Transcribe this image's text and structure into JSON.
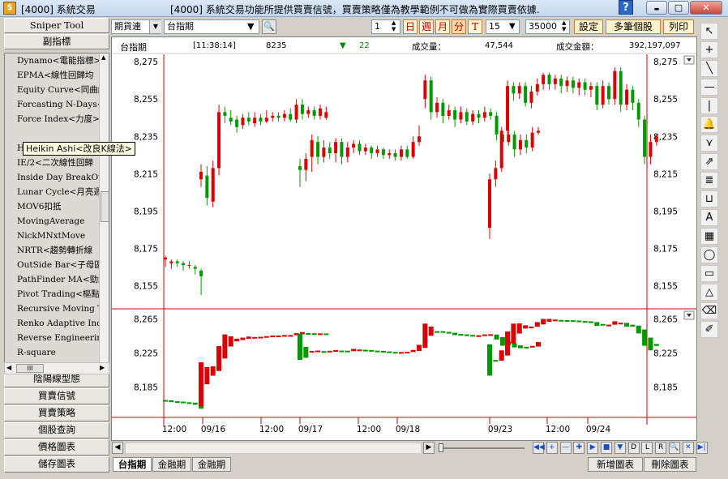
{
  "window": {
    "app_title": "[4000] 系統交易",
    "notice": "[4000] 系統交易功能所提供買賣信號，買賣策略僅為教學範例不可做為實際買賣依據.",
    "help_label": "?",
    "min_label": "▬",
    "max_label": "▢",
    "close_label": "✕"
  },
  "left_panel": {
    "top_buttons": [
      "Sniper Tool",
      "副指標"
    ],
    "indicators": [
      "Dynamo<電能指標>",
      "EPMA<線性回歸均",
      "Equity Curve<同曲線",
      "Forcasting N-Days<",
      "Force Index<力度>",
      "Heikin Ashi<改良K線法>",
      "HighLowLine<高低線",
      "IE/2<二次線性回歸",
      "Inside Day BreakOut",
      "Lunar Cycle<月亮週",
      "MOV6扣抵",
      "MovingAverage",
      "NickMNxtMove",
      "NRTR<趨勢轉折線",
      "OutSide Bar<子母區",
      "PathFinder MA<勁線",
      "Pivot Trading<樞點",
      "Recursive Moving T.",
      "Renko Adaptive Indi",
      "Reverse Engineering",
      "R-square"
    ],
    "tooltip": "Heikin Ashi<改良K線法>",
    "hscroll_label": "III",
    "bottom_buttons": [
      "陰陽線型態",
      "買賣信號",
      "買賣策略",
      "個股查詢",
      "價格圖表",
      "儲存圖表"
    ]
  },
  "toolbar": {
    "contract": "期貨連",
    "symbol": "台指期",
    "period_count": "1",
    "period_buttons": [
      "日",
      "週",
      "月",
      "分",
      "T"
    ],
    "interval": "15",
    "bars": "35000",
    "settings_label": "設定",
    "multi_label": "多筆個股",
    "print_label": "列印"
  },
  "quote": {
    "symbol": "台指期",
    "time": "[11:38:14]",
    "price": "8235",
    "arrow": "▼",
    "change": "22",
    "volume_label": "成交量：",
    "volume": "47,544",
    "amount_label": "成交金額：",
    "amount": "392,197,097"
  },
  "chart_data": [
    {
      "type": "candlestick",
      "panel": "main",
      "y_ticks": [
        "8,275",
        "8,255",
        "8,235",
        "8,215",
        "8,195",
        "8,175",
        "8,155"
      ],
      "ylim": [
        8143,
        8279
      ],
      "candles": [
        [
          8169,
          8170,
          8165,
          8171
        ],
        [
          8167,
          8168,
          8164,
          8169
        ],
        [
          8168,
          8167,
          8165,
          8169
        ],
        [
          8167,
          8166,
          8163,
          8168
        ],
        [
          8166,
          8166,
          8164,
          8168
        ],
        [
          8165,
          8164,
          8161,
          8166
        ],
        [
          8163,
          8160,
          8150,
          8164
        ],
        [
          8212,
          8216,
          8208,
          8220
        ],
        [
          8214,
          8202,
          8198,
          8219
        ],
        [
          8200,
          8218,
          8197,
          8222
        ],
        [
          8218,
          8248,
          8214,
          8252
        ],
        [
          8248,
          8246,
          8242,
          8251
        ],
        [
          8245,
          8243,
          8241,
          8249
        ],
        [
          8244,
          8240,
          8237,
          8246
        ],
        [
          8241,
          8245,
          8239,
          8247
        ],
        [
          8245,
          8243,
          8241,
          8248
        ],
        [
          8242,
          8245,
          8240,
          8248
        ],
        [
          8245,
          8243,
          8241,
          8247
        ],
        [
          8243,
          8245,
          8242,
          8249
        ],
        [
          8245,
          8246,
          8243,
          8248
        ],
        [
          8246,
          8245,
          8243,
          8248
        ],
        [
          8245,
          8247,
          8243,
          8249
        ],
        [
          8247,
          8244,
          8243,
          8250
        ],
        [
          8244,
          8252,
          8242,
          8255
        ],
        [
          8252,
          8247,
          8244,
          8255
        ],
        [
          8247,
          8249,
          8245,
          8251
        ],
        [
          8249,
          8246,
          8244,
          8251
        ],
        [
          8246,
          8250,
          8244,
          8252
        ],
        [
          8245,
          8248,
          8244,
          8251
        ],
        [
          8219,
          8217,
          8208,
          8223
        ],
        [
          8217,
          8223,
          8211,
          8226
        ],
        [
          8224,
          8233,
          8216,
          8236
        ],
        [
          8232,
          8224,
          8220,
          8235
        ],
        [
          8224,
          8229,
          8221,
          8233
        ],
        [
          8229,
          8226,
          8223,
          8232
        ],
        [
          8226,
          8232,
          8221,
          8234
        ],
        [
          8232,
          8224,
          8220,
          8234
        ],
        [
          8224,
          8229,
          8221,
          8232
        ],
        [
          8229,
          8231,
          8226,
          8233
        ],
        [
          8231,
          8227,
          8225,
          8233
        ],
        [
          8227,
          8229,
          8225,
          8231
        ],
        [
          8229,
          8226,
          8223,
          8230
        ],
        [
          8226,
          8228,
          8224,
          8230
        ],
        [
          8228,
          8225,
          8223,
          8229
        ],
        [
          8225,
          8226,
          8223,
          8228
        ],
        [
          8226,
          8224,
          8222,
          8228
        ],
        [
          8224,
          8228,
          8222,
          8230
        ],
        [
          8228,
          8224,
          8223,
          8230
        ],
        [
          8224,
          8232,
          8223,
          8235
        ],
        [
          8232,
          8235,
          8230,
          8241
        ],
        [
          8255,
          8265,
          8250,
          8268
        ],
        [
          8265,
          8248,
          8244,
          8267
        ],
        [
          8248,
          8253,
          8245,
          8256
        ],
        [
          8253,
          8246,
          8242,
          8255
        ],
        [
          8246,
          8249,
          8244,
          8252
        ],
        [
          8249,
          8244,
          8240,
          8251
        ],
        [
          8244,
          8248,
          8242,
          8251
        ],
        [
          8248,
          8243,
          8241,
          8250
        ],
        [
          8243,
          8247,
          8241,
          8249
        ],
        [
          8247,
          8245,
          8242,
          8249
        ],
        [
          8245,
          8248,
          8243,
          8251
        ],
        [
          8248,
          8246,
          8244,
          8250
        ],
        [
          8246,
          8236,
          8233,
          8248
        ],
        [
          8236,
          8232,
          8228,
          8238
        ],
        [
          8232,
          8236,
          8230,
          8238
        ],
        [
          8236,
          8228,
          8224,
          8238
        ],
        [
          8228,
          8233,
          8225,
          8236
        ],
        [
          8233,
          8229,
          8226,
          8236
        ],
        [
          8229,
          8237,
          8227,
          8240
        ],
        [
          8237,
          8238,
          8236,
          8240
        ],
        [
          8186,
          8212,
          8180,
          8215
        ],
        [
          8212,
          8218,
          8208,
          8222
        ],
        [
          8218,
          8238,
          8216,
          8240
        ],
        [
          8238,
          8262,
          8236,
          8265
        ],
        [
          8262,
          8258,
          8254,
          8264
        ],
        [
          8258,
          8262,
          8255,
          8264
        ],
        [
          8262,
          8253,
          8251,
          8264
        ],
        [
          8253,
          8259,
          8250,
          8262
        ],
        [
          8259,
          8263,
          8257,
          8266
        ],
        [
          8263,
          8268,
          8260,
          8269
        ],
        [
          8268,
          8263,
          8260,
          8269
        ],
        [
          8263,
          8266,
          8260,
          8268
        ],
        [
          8266,
          8262,
          8258,
          8268
        ],
        [
          8262,
          8265,
          8259,
          8267
        ],
        [
          8265,
          8261,
          8258,
          8267
        ],
        [
          8261,
          8264,
          8257,
          8266
        ],
        [
          8264,
          8260,
          8257,
          8266
        ],
        [
          8260,
          8262,
          8256,
          8264
        ],
        [
          8262,
          8252,
          8249,
          8264
        ],
        [
          8252,
          8262,
          8250,
          8265
        ],
        [
          8262,
          8255,
          8252,
          8264
        ],
        [
          8255,
          8270,
          8252,
          8272
        ],
        [
          8270,
          8252,
          8248,
          8272
        ],
        [
          8252,
          8260,
          8249,
          8263
        ],
        [
          8260,
          8253,
          8249,
          8262
        ],
        [
          8253,
          8244,
          8240,
          8255
        ],
        [
          8244,
          8224,
          8220,
          8246
        ],
        [
          8224,
          8232,
          8220,
          8236
        ],
        [
          8232,
          8235,
          8230,
          8236
        ]
      ]
    },
    {
      "type": "heikin-ashi",
      "panel": "sub",
      "y_ticks": [
        "8,265",
        "8,225",
        "8,185"
      ],
      "ylim": [
        8150,
        8276
      ]
    }
  ],
  "x_axis_labels": [
    "12:00",
    "09/16",
    "12:00",
    "09/17",
    "12:00",
    "09/18",
    "09/23",
    "12:00",
    "09/24"
  ],
  "bottom_tabs": [
    "台指期",
    "金融期",
    "金融期"
  ],
  "bottom_right_buttons": [
    "新增圖表",
    "刪除圖表"
  ],
  "nav_buttons": [
    "◀◀",
    "+",
    "—",
    "✚",
    "▶",
    "■",
    "▼",
    "D",
    "L",
    "R",
    "🔍",
    "✕",
    "▶|"
  ],
  "right_tools": [
    "pointer",
    "crosshair",
    "line",
    "hline",
    "vline",
    "bell",
    "fan",
    "arrows",
    "text-box",
    "corner",
    "A",
    "grid",
    "ellipse",
    "rect",
    "triangle",
    "eraser",
    "eraser2"
  ]
}
